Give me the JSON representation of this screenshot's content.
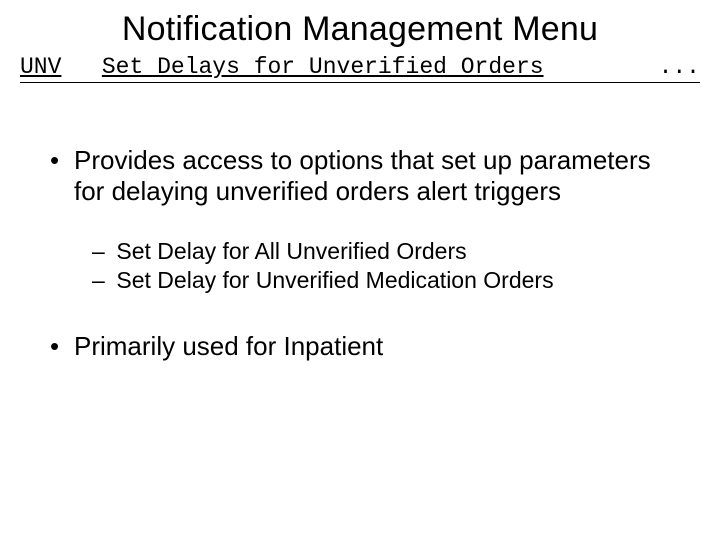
{
  "title": "Notification Management Menu",
  "menu": {
    "code": "UNV",
    "label": "Set Delays for Unverified Orders",
    "dots": "..."
  },
  "bullets": [
    {
      "text": "Provides access to options that set up parameters for delaying unverified orders alert triggers",
      "sub": [
        "Set Delay for All Unverified Orders",
        "Set Delay for Unverified Medication Orders"
      ]
    },
    {
      "text": "Primarily used for Inpatient",
      "sub": []
    }
  ]
}
